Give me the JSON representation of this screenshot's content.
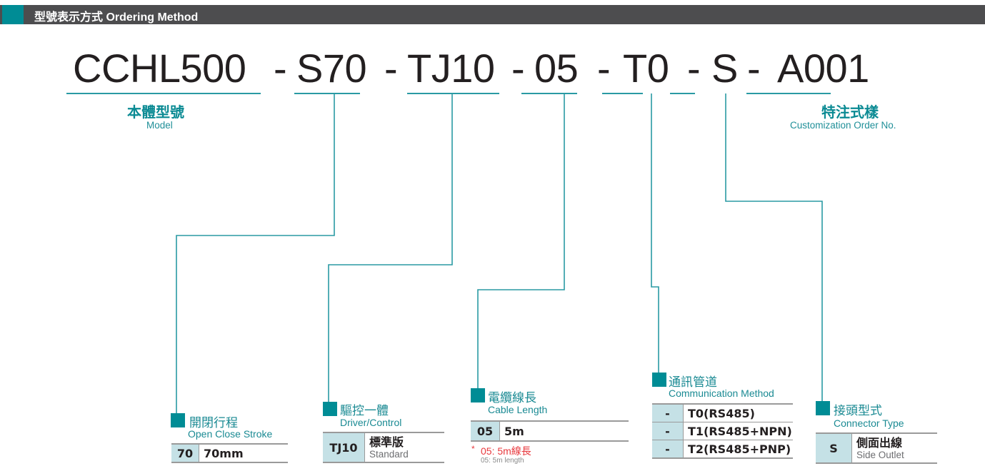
{
  "header": {
    "title": "型號表示方式 Ordering Method",
    "accent_color": "#008c95",
    "bar_color": "#4d4d4f"
  },
  "model_code": {
    "segments": [
      "CCHL500",
      "S70",
      "TJ10",
      "05",
      "T0",
      "S",
      "A001"
    ],
    "separator": "-"
  },
  "captions": {
    "model": {
      "zh": "本體型號",
      "en": "Model"
    },
    "custom": {
      "zh": "特注式樣",
      "en": "Customization Order No."
    }
  },
  "groups": {
    "stroke": {
      "zh": "開閉行程",
      "en": "Open Close Stroke",
      "rows": [
        {
          "code": "70",
          "value": "70mm"
        }
      ]
    },
    "driver": {
      "zh": "驅控一體",
      "en": "Driver/Control",
      "rows": [
        {
          "code": "TJ10",
          "value_zh": "標準版",
          "value_en": "Standard"
        }
      ]
    },
    "cable": {
      "zh": "電纜線長",
      "en": "Cable Length",
      "rows": [
        {
          "code": "05",
          "value": "5m"
        }
      ],
      "note": {
        "star": "*",
        "zh": "05: 5m線長",
        "en": "05: 5m length"
      }
    },
    "comm": {
      "zh": "通訊管道",
      "en": "Communication Method",
      "rows": [
        {
          "code": "-",
          "value": "T0(RS485)"
        },
        {
          "code": "-",
          "value": "T1(RS485+NPN)"
        },
        {
          "code": "-",
          "value": "T2(RS485+PNP)"
        }
      ]
    },
    "connector": {
      "zh": "接頭型式",
      "en": "Connector Type",
      "rows": [
        {
          "code": "S",
          "value_zh": "側面出線",
          "value_en": "Side Outlet"
        }
      ]
    }
  },
  "colors": {
    "teal": "#008c95",
    "line": "#2a9aa3",
    "key_cell": "#c5e1e6",
    "note_red": "#e8383d"
  }
}
